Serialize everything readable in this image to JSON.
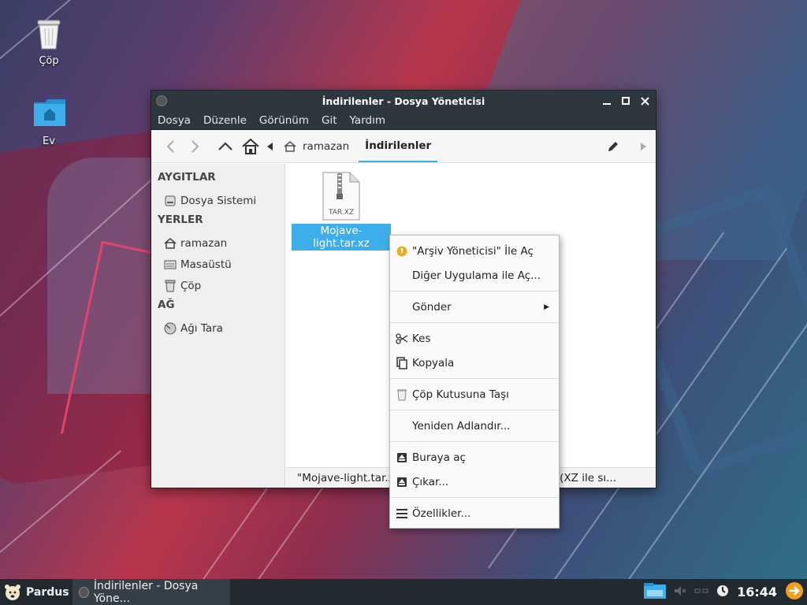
{
  "desktop": {
    "icons": [
      {
        "label": "Çöp"
      },
      {
        "label": "Ev"
      }
    ]
  },
  "window": {
    "title": "İndirilenler - Dosya Yöneticisi",
    "menu": [
      "Dosya",
      "Düzenle",
      "Görünüm",
      "Git",
      "Yardım"
    ],
    "breadcrumb": [
      "ramazan",
      "İndirilenler"
    ],
    "sidebar": {
      "devices_header": "AYGITLAR",
      "devices": [
        {
          "label": "Dosya Sistemi",
          "icon": "drive-icon"
        }
      ],
      "places_header": "YERLER",
      "places": [
        {
          "label": "ramazan",
          "icon": "home-icon"
        },
        {
          "label": "Masaüstü",
          "icon": "desktop-icon"
        },
        {
          "label": "Çöp",
          "icon": "trash-icon"
        }
      ],
      "network_header": "AĞ",
      "network": [
        {
          "label": "Ağı Tara",
          "icon": "network-icon"
        }
      ]
    },
    "file": {
      "name": "Mojave-light.tar.xz",
      "badge": "TAR.XZ"
    },
    "status": "\"Mojave-light.tar.xz\" (XZ ile sıkıştırılmış tar arşivi (XZ ile sı..."
  },
  "context_menu": {
    "items": [
      {
        "label": "\"Arşiv Yöneticisi\" İle Aç",
        "icon": "archive-manager-icon"
      },
      {
        "label": "Diğer Uygulama ile Aç...",
        "icon": ""
      },
      {
        "label": "Gönder",
        "icon": "",
        "submenu": true
      },
      {
        "label": "Kes",
        "icon": "scissors-icon"
      },
      {
        "label": "Kopyala",
        "icon": "copy-icon"
      },
      {
        "label": "Çöp Kutusuna Taşı",
        "icon": "trash-icon"
      },
      {
        "label": "Yeniden Adlandır...",
        "icon": ""
      },
      {
        "label": "Buraya aç",
        "icon": "extract-icon"
      },
      {
        "label": "Çıkar...",
        "icon": "extract-icon"
      },
      {
        "label": "Özellikler...",
        "icon": "properties-icon"
      }
    ]
  },
  "taskbar": {
    "start_label": "Pardus",
    "task_label": "İndirilenler - Dosya Yöne...",
    "clock": "16:44"
  }
}
